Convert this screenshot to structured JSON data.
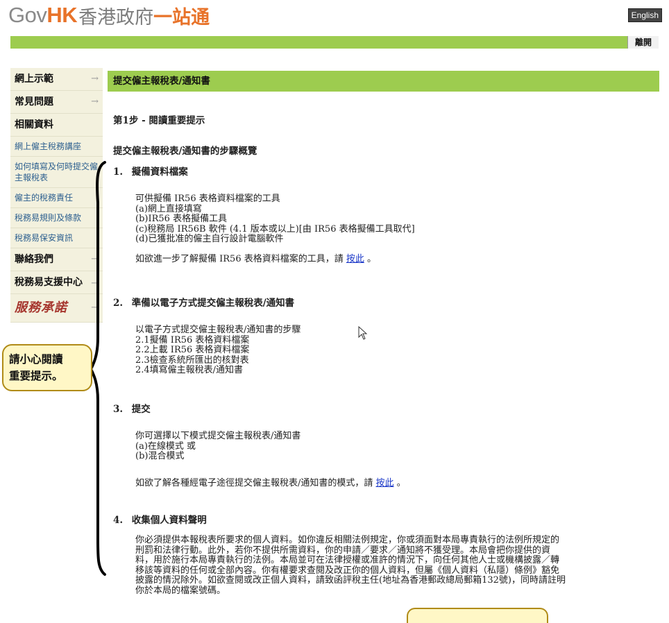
{
  "header": {
    "logo_gov": "Gov",
    "logo_hk": "HK",
    "logo_cn1": "香港政府",
    "logo_cn2": "一站通",
    "lang_button": "English",
    "logout": "離開"
  },
  "sidebar": {
    "items": [
      {
        "label": "網上示範",
        "type": "main",
        "arrow": "→"
      },
      {
        "label": "常見問題",
        "type": "main",
        "arrow": "→"
      },
      {
        "label": "相關資料",
        "type": "main"
      },
      {
        "label": "網上僱主稅務講座",
        "type": "sub"
      },
      {
        "label": "如何填寫及何時提交僱主報稅表",
        "type": "sub"
      },
      {
        "label": "僱主的稅務責任",
        "type": "sub"
      },
      {
        "label": "稅務易規則及條款",
        "type": "sub"
      },
      {
        "label": "稅務易保安資訊",
        "type": "sub"
      },
      {
        "label": "聯絡我們",
        "type": "main",
        "arrow": "→"
      },
      {
        "label": "稅務易支援中心",
        "type": "main",
        "arrow": "→"
      },
      {
        "label": "服務承諾",
        "type": "logo",
        "arrow": "→"
      }
    ]
  },
  "annotation": {
    "line1": "請小心閱讀",
    "line2": "重要提示。"
  },
  "main": {
    "title": "提交僱主報稅表/通知書",
    "step": "第1步 - 閱讀重要提示",
    "overview": "提交僱主報稅表/通知書的步驟概覽",
    "sections": [
      {
        "num": "1.",
        "heading": "擬備資料檔案",
        "lines": [
          "可供擬備 IR56 表格資料檔案的工具",
          "(a)網上直接填寫",
          "(b)IR56 表格擬備工具",
          "(c)稅務局 IR56B 軟件 (4.1 版本或以上)[由 IR56 表格擬備工具取代]",
          "(d)已獲批准的僱主自行設計電腦軟件"
        ],
        "note_pre": "如欲進一步了解擬備 IR56 表格資料檔案的工具，請 ",
        "note_link": "按此",
        "note_post": " 。"
      },
      {
        "num": "2.",
        "heading": "準備以電子方式提交僱主報稅表/通知書",
        "lines": [
          "以電子方式提交僱主報稅表/通知書的步驟",
          "2.1擬備 IR56 表格資料檔案",
          "2.2上載 IR56 表格資料檔案",
          "2.3檢查系統所匯出的核對表",
          "2.4填寫僱主報稅表/通知書"
        ]
      },
      {
        "num": "3.",
        "heading": "提交",
        "lines": [
          "你可選擇以下模式提交僱主報稅表/通知書",
          "(a)在線模式 或",
          "(b)混合模式"
        ],
        "note_pre": "如欲了解各種經電子途徑提交僱主報稅表/通知書的模式，請 ",
        "note_link": "按此",
        "note_post": " 。"
      },
      {
        "num": "4.",
        "heading": "收集個人資料聲明",
        "lines": [
          "你必須提供本報稅表所要求的個人資料。如你違反相關法例規定，你或須面對本局專責執行的法例所規定的",
          "刑罰和法律行動。此外，若你不提供所需資料，你的申請／要求／通知將不獲受理。本局會把你提供的資",
          "料，用於施行本局專責執行的法例。本局並可在法律授權或准許的情況下，向任何其他人士或機構披露／轉",
          "移該等資料的任何或全部內容。你有權要求查閱及改正你的個人資料，但屬《個人資料（私隱）條例》豁免",
          "披露的情況除外。如欲查閱或改正個人資料，請致函評稅主任(地址為香港郵政總局郵箱132號)，同時請註明",
          "你於本局的檔案號碼。"
        ]
      }
    ]
  }
}
